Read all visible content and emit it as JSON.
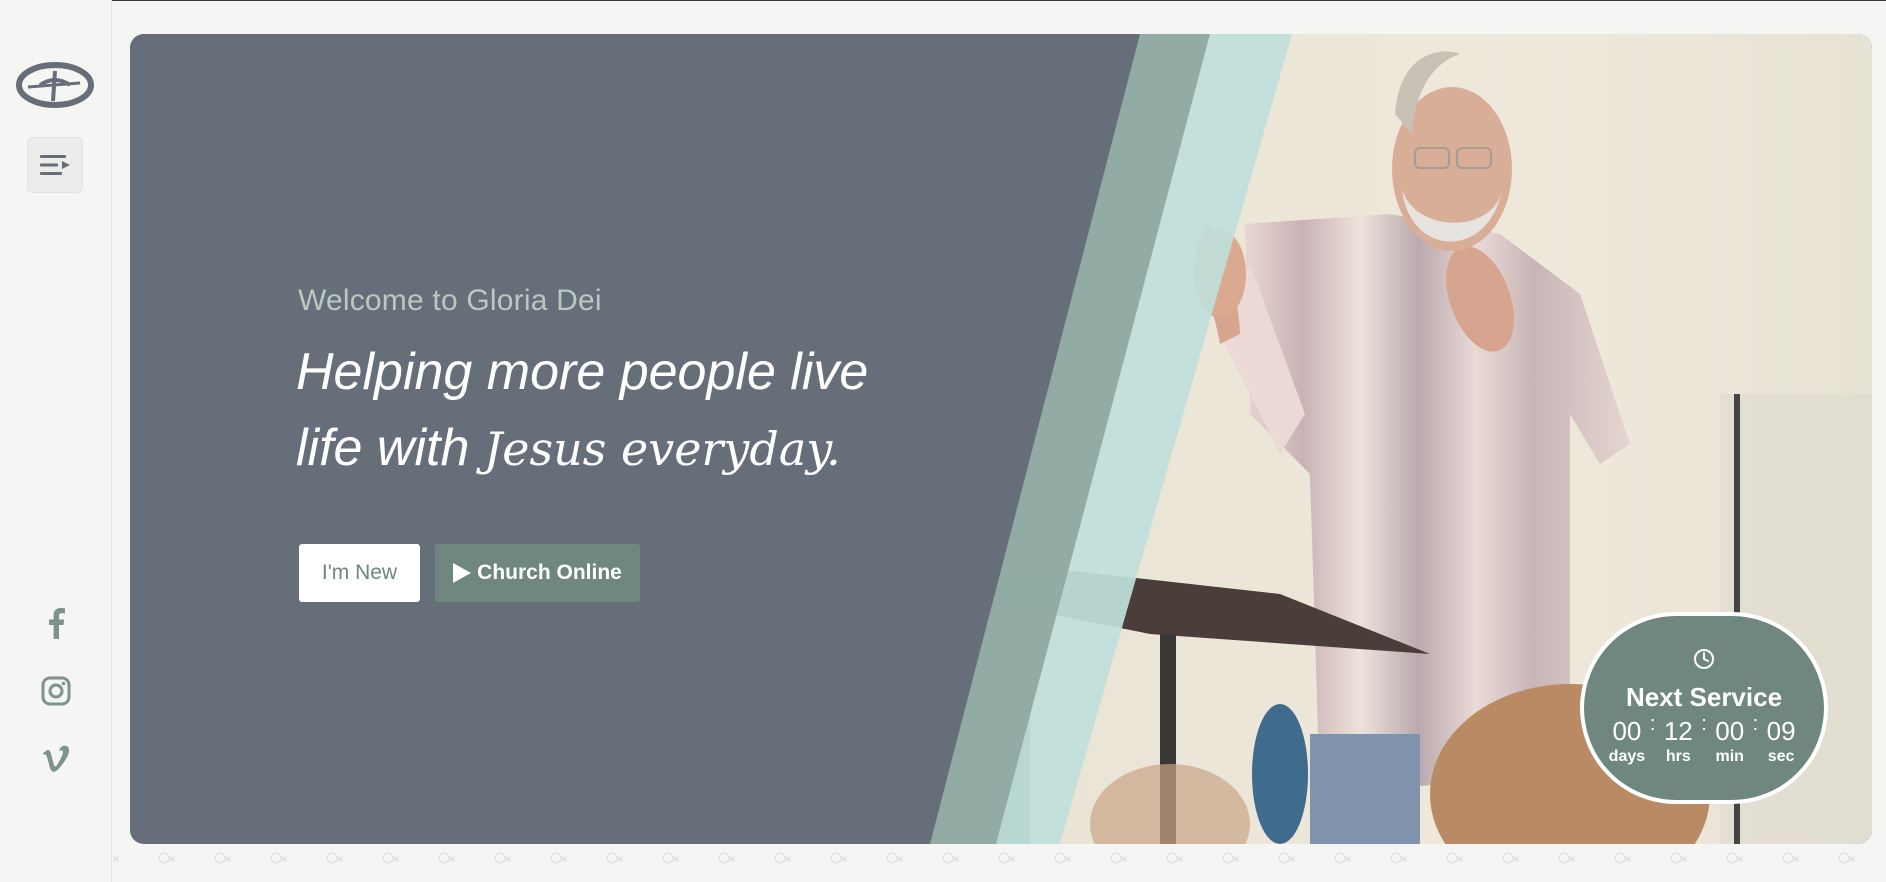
{
  "sidebar": {
    "logo": "gloria-dei-logo",
    "menu_icon": "menu-lines-icon",
    "social": [
      {
        "name": "facebook-icon"
      },
      {
        "name": "instagram-icon"
      },
      {
        "name": "vimeo-icon"
      }
    ]
  },
  "hero": {
    "welcome": "Welcome to Gloria Dei",
    "headline_part1": "Helping more people live",
    "headline_part2": "life with",
    "headline_part3": "Jesus everyday.",
    "buttons": {
      "new_label": "I'm New",
      "online_label": "Church Online",
      "online_icon": "play-icon"
    }
  },
  "countdown": {
    "icon": "clock-icon",
    "title": "Next Service",
    "units": [
      {
        "value": "00",
        "label": "days"
      },
      {
        "value": "12",
        "label": "hrs"
      },
      {
        "value": "00",
        "label": "min"
      },
      {
        "value": "09",
        "label": "sec"
      }
    ]
  },
  "colors": {
    "hero_bg": "#666e79",
    "accent_green": "#6f877f",
    "mint": "#bfe0da",
    "welcome_text": "#b9c9c0"
  }
}
